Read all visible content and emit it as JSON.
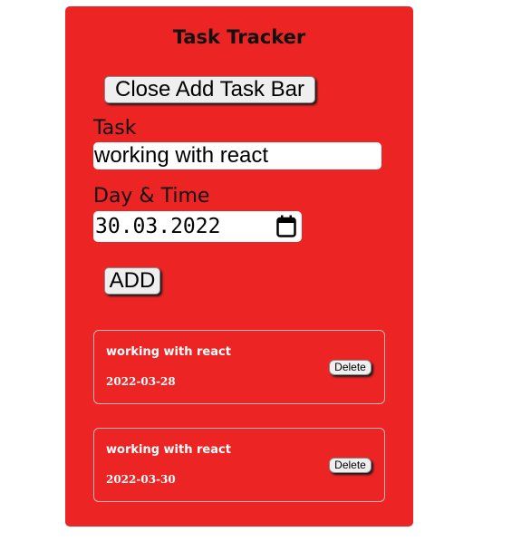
{
  "app": {
    "title": "Task Tracker"
  },
  "toolbar": {
    "toggle_label": "Close Add Task Bar"
  },
  "form": {
    "task_label": "Task",
    "task_value": "working with react",
    "day_label": "Day & Time",
    "day_value": "30.03.2022",
    "submit_label": "ADD"
  },
  "tasks": [
    {
      "text": "working with react",
      "date": "2022-03-28",
      "delete_label": "Delete"
    },
    {
      "text": "working with react",
      "date": "2022-03-30",
      "delete_label": "Delete"
    }
  ],
  "colors": {
    "panel_background": "#ec2424",
    "text_light": "#ffffff"
  },
  "icons": {
    "date_picker": "calendar-icon"
  }
}
